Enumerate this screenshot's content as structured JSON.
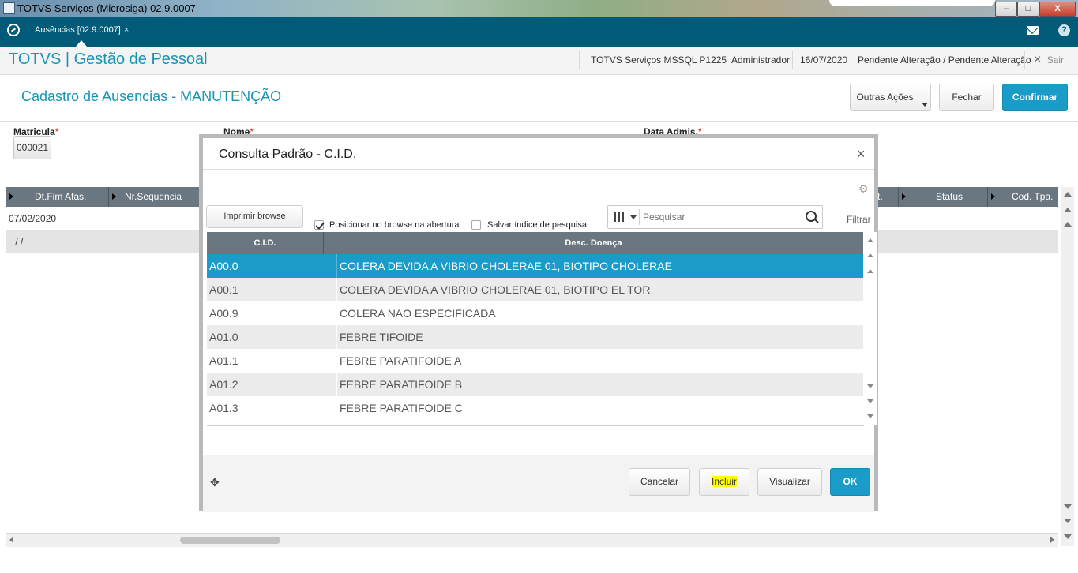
{
  "window": {
    "title": "TOTVS Serviços (Microsiga) 02.9.0007",
    "controls": {
      "minimize": "–",
      "maximize": "□",
      "close": "X"
    }
  },
  "appbar": {
    "tab_label": "Ausências [02.9.0007]",
    "tab_close": "×",
    "help": "?"
  },
  "header": {
    "brand": "TOTVS | Gestão de Pessoal",
    "environment": "TOTVS Serviços MSSQL P1225",
    "user": "Administrador",
    "date": "16/07/2020",
    "status": "Pendente Alteração / Pendente Alteração",
    "exit_label": "Sair",
    "exit_icon": "×"
  },
  "page": {
    "title": "Cadastro de Ausencias - MANUTENÇÃO",
    "buttons": {
      "more_actions": "Outras Ações",
      "close": "Fechar",
      "confirm": "Confirmar"
    }
  },
  "form": {
    "matricula_label": "Matricula",
    "matricula_value": "000021",
    "nome_label": "Nome",
    "data_admis_label": "Data Admis.",
    "required_mark": "*"
  },
  "grid": {
    "headers": [
      "Dt.Fim Afas.",
      "Nr.Sequencia",
      "t.",
      "Status",
      "Cod. Tpa."
    ],
    "rows": [
      {
        "dt_fim": "07/02/2020"
      },
      {
        "dt_fim": " / /"
      }
    ]
  },
  "modal": {
    "title": "Consulta Padrão - C.I.D.",
    "close_icon": "×",
    "print_button": "Imprimir browse",
    "checkbox_position": {
      "label": "Posicionar no browse na abertura",
      "checked": true
    },
    "checkbox_save_index": {
      "label": "Salvar índice de pesquisa",
      "checked": false
    },
    "search_placeholder": "Pesquisar",
    "filter_label": "Filtrar",
    "columns": [
      "C.I.D.",
      "Desc. Doença"
    ],
    "rows": [
      {
        "cid": "A00.0",
        "desc": "COLERA DEVIDA A VIBRIO CHOLERAE 01, BIOTIPO CHOLERAE"
      },
      {
        "cid": "A00.1",
        "desc": "COLERA DEVIDA A VIBRIO CHOLERAE 01, BIOTIPO EL TOR"
      },
      {
        "cid": "A00.9",
        "desc": "COLERA NAO ESPECIFICADA"
      },
      {
        "cid": "A01.0",
        "desc": "FEBRE TIFOIDE"
      },
      {
        "cid": "A01.1",
        "desc": "FEBRE PARATIFOIDE A"
      },
      {
        "cid": "A01.2",
        "desc": "FEBRE PARATIFOIDE B"
      },
      {
        "cid": "A01.3",
        "desc": "FEBRE PARATIFOIDE C"
      }
    ],
    "selected_row": 0,
    "move_icon": "✥",
    "gear_icon": "⚙",
    "footer_buttons": {
      "cancel": "Cancelar",
      "include": "Incluir",
      "view": "Visualizar",
      "ok": "OK"
    }
  },
  "colors": {
    "accent": "#1a94b4",
    "primary_button": "#1a9bc8",
    "appbar": "#005a78",
    "grid_header": "#6a7780",
    "required": "#e0252f",
    "highlight": "#ffff00"
  }
}
